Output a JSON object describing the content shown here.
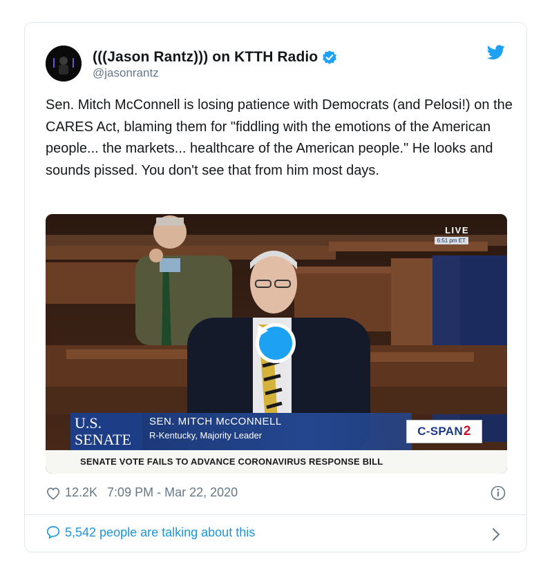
{
  "tweet": {
    "display_name": "(((Jason Rantz))) on KTTH Radio",
    "handle": "@jasonrantz",
    "text": "Sen. Mitch McConnell is losing patience with Democrats (and Pelosi!) on the CARES Act, blaming them for \"fiddling with the emotions of the American people... the markets... healthcare of the American people.\" He looks and sounds pissed. You don't see that from him most days.",
    "likes": "12.2K",
    "timestamp": "7:09 PM - Mar 22, 2020",
    "talking_about": "5,542 people are talking about this"
  },
  "video": {
    "live_label": "LIVE",
    "live_time": "6:51 pm ET",
    "senate_logo_line1": "U.S.",
    "senate_logo_line2": "SENATE",
    "lower_third_name": "SEN. MITCH McCONNELL",
    "lower_third_title": "R-Kentucky, Majority Leader",
    "network_prefix": "C-SPAN",
    "network_suffix": "2",
    "ticker": "SENATE VOTE FAILS TO ADVANCE CORONAVIRUS RESPONSE BILL"
  },
  "colors": {
    "accent": "#1da1f2",
    "link": "#1b95e0",
    "muted": "#657786",
    "border": "#e1e8ed",
    "senate_blue": "#1d3e86",
    "cspan_red": "#c8102e"
  },
  "icons": [
    "avatar",
    "verified-badge-icon",
    "twitter-bird-icon",
    "play-icon",
    "heart-icon",
    "info-icon",
    "reply-bubble-icon",
    "chevron-right-icon"
  ]
}
